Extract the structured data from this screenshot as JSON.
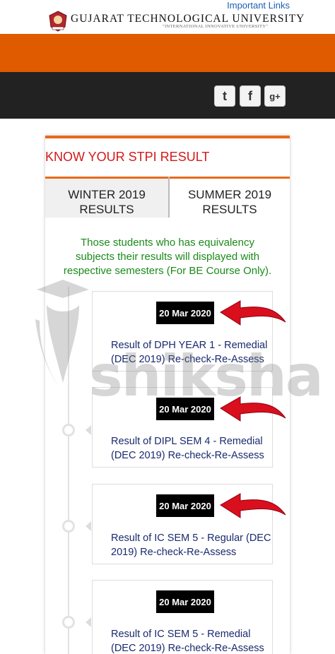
{
  "header": {
    "important_links": "Important Links",
    "university_name": "GUJARAT TECHNOLOGICAL UNIVERSITY",
    "tagline": "\"INTERNATIONAL INNOVATIVE UNIVERSITY\""
  },
  "social": {
    "twitter": "t",
    "facebook": "f",
    "googleplus": "g+"
  },
  "card": {
    "title": "KNOW YOUR STPI RESULT",
    "tabs": [
      {
        "line1": "WINTER 2019",
        "line2": "RESULTS"
      },
      {
        "line1": "SUMMER 2019",
        "line2": "RESULTS"
      }
    ],
    "notice": "Those students who has equivalency subjects their results will displayed with respective semesters (For BE Course Only)."
  },
  "results": [
    {
      "date": "20 Mar 2020",
      "title": "Result of DPH YEAR 1 - Remedial (DEC 2019) Re-check-Re-Assess"
    },
    {
      "date": "20 Mar 2020",
      "title": "Result of DIPL SEM 4 - Remedial (DEC 2019) Re-check-Re-Assess"
    },
    {
      "date": "20 Mar 2020",
      "title": "Result of IC SEM 5 - Regular (DEC 2019) Re-check-Re-Assess"
    },
    {
      "date": "20 Mar 2020",
      "title": "Result of IC SEM 5 - Remedial (DEC 2019) Re-check-Re-Assess"
    }
  ],
  "watermark": "shiksha",
  "colors": {
    "orange": "#e05a00",
    "dark": "#222222",
    "title_red": "#d11a1a",
    "notice_green": "#1a8a1a",
    "link_navy": "#1a2a6e",
    "arrow_red": "#d90f1e"
  }
}
